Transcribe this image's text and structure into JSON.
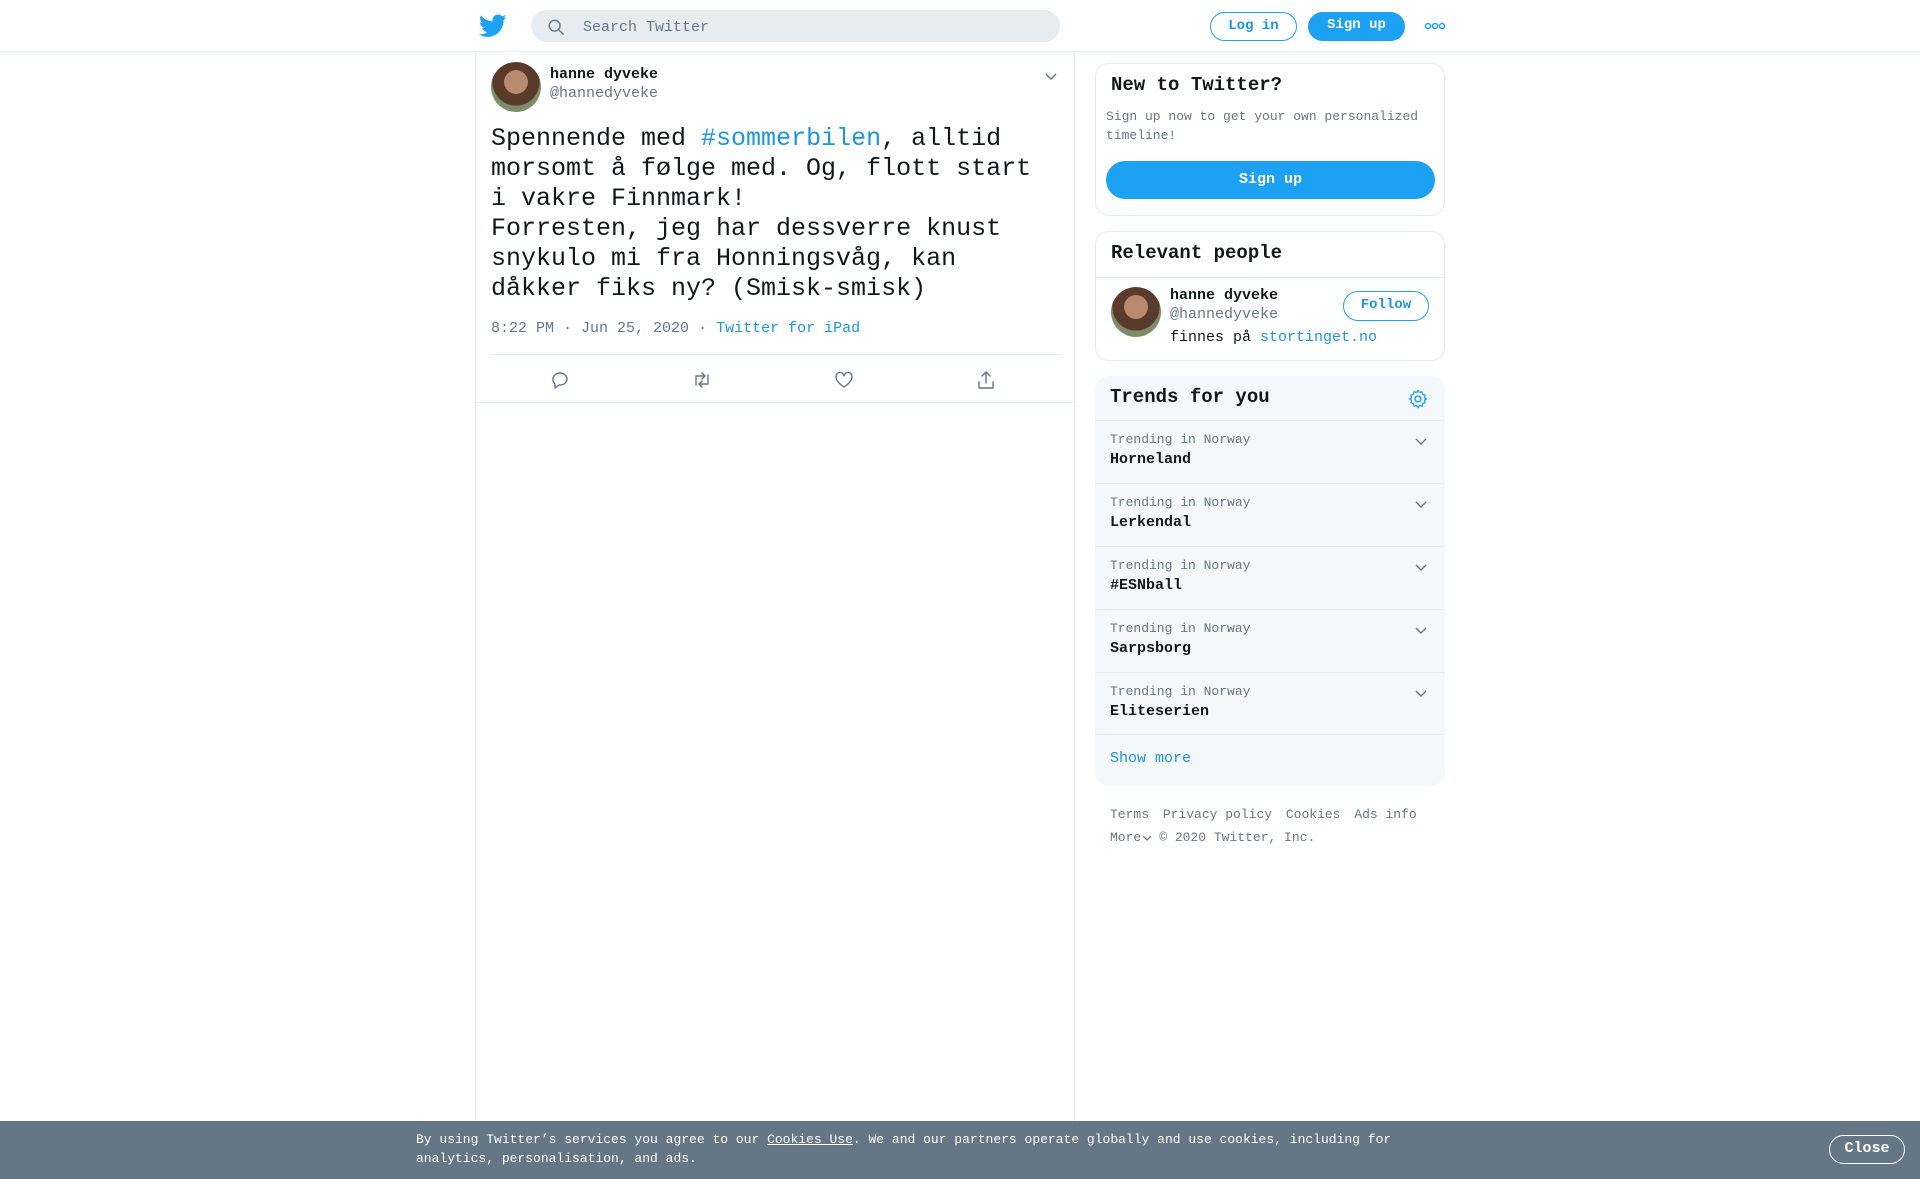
{
  "header": {
    "search_placeholder": "Search Twitter",
    "login_label": "Log in",
    "signup_label": "Sign up",
    "icons": [
      "twitter-logo-icon",
      "search-icon",
      "more-dots-icon"
    ]
  },
  "tweet": {
    "author_name": "hanne dyveke",
    "author_handle": "@hannedyveke",
    "text_before": "Spennende med ",
    "hashtag": "#sommerbilen",
    "text_after": ", alltid morsomt å følge med. Og, flott start i vakre Finnmark!",
    "text_line2": "Forresten, jeg har dessverre knust snykulo mi fra Honningsvåg, kan dåkker fiks ny? (Smisk-smisk)",
    "time": "8:22 PM · Jun 25, 2020",
    "separator": "·",
    "source": "Twitter for iPad",
    "actions": [
      "reply-icon",
      "retweet-icon",
      "like-icon",
      "share-icon"
    ]
  },
  "new_to_twitter": {
    "title": "New to Twitter?",
    "description": "Sign up now to get your own personalized timeline!",
    "button": "Sign up"
  },
  "relevant_people": {
    "title": "Relevant people",
    "name": "hanne dyveke",
    "handle": "@hannedyveke",
    "bio_prefix": "finnes på ",
    "bio_link": "stortinget.no",
    "follow_label": "Follow"
  },
  "trends": {
    "title": "Trends for you",
    "items": [
      {
        "context": "Trending in Norway",
        "name": "Horneland"
      },
      {
        "context": "Trending in Norway",
        "name": "Lerkendal"
      },
      {
        "context": "Trending in Norway",
        "name": "#ESNball"
      },
      {
        "context": "Trending in Norway",
        "name": "Sarpsborg"
      },
      {
        "context": "Trending in Norway",
        "name": "Eliteserien"
      }
    ],
    "show_more": "Show more"
  },
  "footer": {
    "terms": "Terms",
    "privacy": "Privacy policy",
    "cookies": "Cookies",
    "ads": "Ads info",
    "more": "More",
    "copyright": "© 2020 Twitter, Inc."
  },
  "cookie_bar": {
    "text_before": "By using Twitter’s services you agree to our ",
    "link": "Cookies Use",
    "text_after": ". We and our partners operate globally and use cookies, including for analytics, personalisation, and ads.",
    "close_label": "Close"
  },
  "colors": {
    "brand_blue": "#1da1f2",
    "link_blue": "#1b95e0",
    "muted": "#657786",
    "border": "#e6ecf0",
    "cookie_bar": "#657786"
  }
}
